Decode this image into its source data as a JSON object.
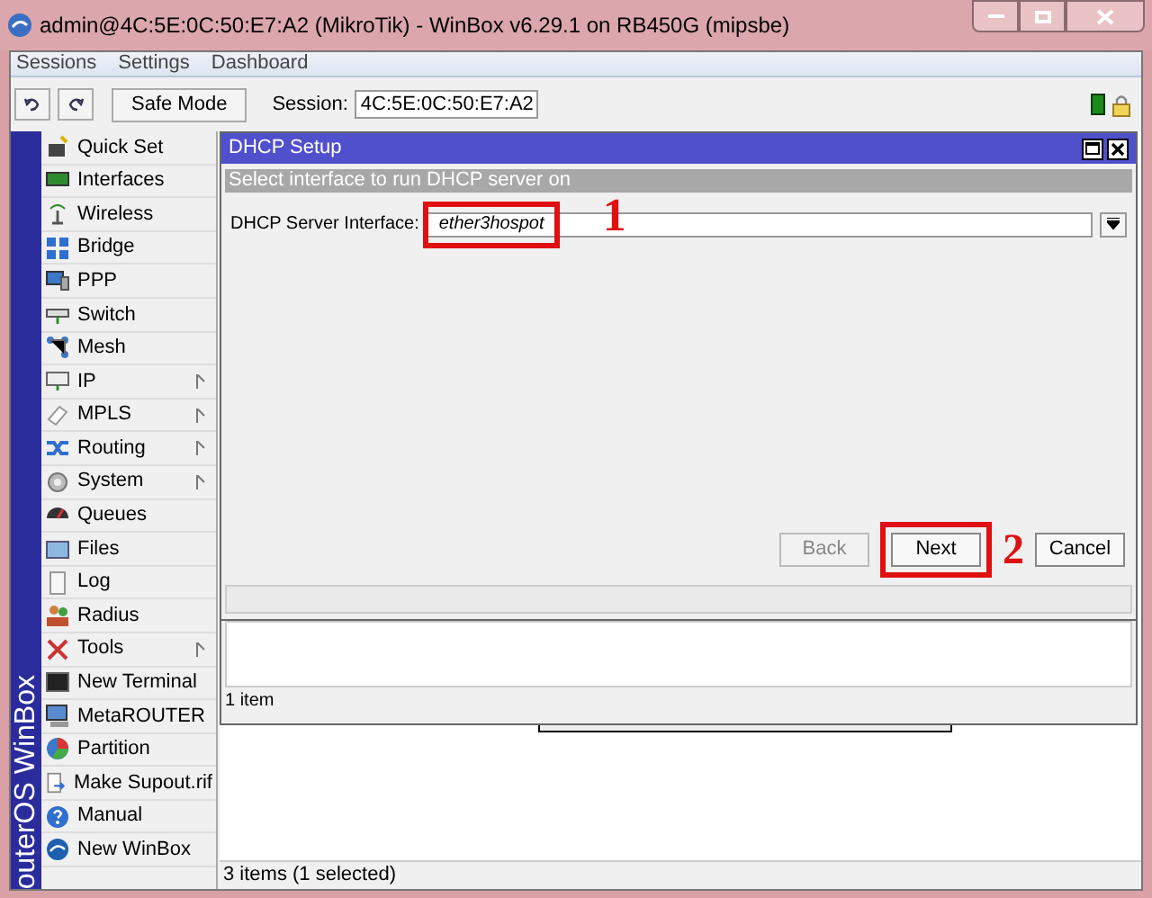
{
  "window": {
    "title": "admin@4C:5E:0C:50:E7:A2 (MikroTik) - WinBox v6.29.1 on RB450G (mipsbe)"
  },
  "menu": [
    "Sessions",
    "Settings",
    "Dashboard"
  ],
  "toolbar": {
    "safe_mode": "Safe Mode",
    "session_label": "Session:",
    "session_value": "4C:5E:0C:50:E7:A2"
  },
  "sidebar": {
    "brand": "outerOS WinBox",
    "items": [
      {
        "label": "Quick Set",
        "submenu": false
      },
      {
        "label": "Interfaces",
        "submenu": false
      },
      {
        "label": "Wireless",
        "submenu": false
      },
      {
        "label": "Bridge",
        "submenu": false
      },
      {
        "label": "PPP",
        "submenu": false
      },
      {
        "label": "Switch",
        "submenu": false
      },
      {
        "label": "Mesh",
        "submenu": false
      },
      {
        "label": "IP",
        "submenu": true
      },
      {
        "label": "MPLS",
        "submenu": true
      },
      {
        "label": "Routing",
        "submenu": true
      },
      {
        "label": "System",
        "submenu": true
      },
      {
        "label": "Queues",
        "submenu": false
      },
      {
        "label": "Files",
        "submenu": false
      },
      {
        "label": "Log",
        "submenu": false
      },
      {
        "label": "Radius",
        "submenu": false
      },
      {
        "label": "Tools",
        "submenu": true
      },
      {
        "label": "New Terminal",
        "submenu": false
      },
      {
        "label": "MetaROUTER",
        "submenu": false
      },
      {
        "label": "Partition",
        "submenu": false
      },
      {
        "label": "Make Supout.rif",
        "submenu": false
      },
      {
        "label": "Manual",
        "submenu": false
      },
      {
        "label": "New WinBox",
        "submenu": false
      }
    ]
  },
  "dialog": {
    "title": "DHCP Setup",
    "header": "Select interface to run DHCP server on",
    "field_label": "DHCP Server Interface:",
    "field_value": "ether3hospot",
    "buttons": [
      {
        "label": "Back",
        "disabled": true
      },
      {
        "label": "Next",
        "disabled": false
      },
      {
        "label": "Cancel",
        "disabled": false
      }
    ]
  },
  "annotations": [
    "1",
    "2"
  ],
  "inner_list": {
    "status": "1 item"
  },
  "status_bar": "3 items (1 selected)"
}
